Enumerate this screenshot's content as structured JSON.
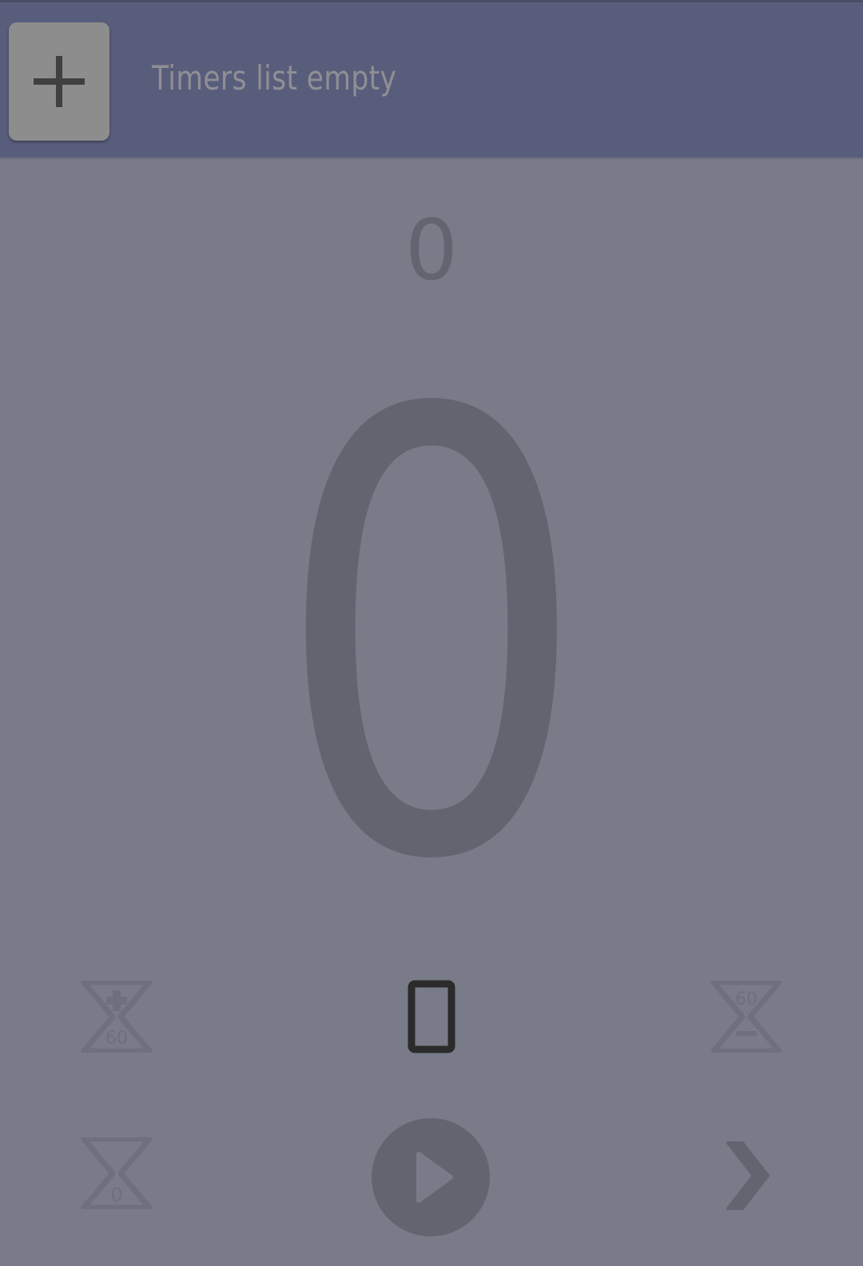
{
  "header": {
    "add_icon": "plus-icon",
    "title": "Timers list empty"
  },
  "counter": {
    "small_value": "0",
    "large_value": "0"
  },
  "controls": {
    "add_60_icon": {
      "name": "hourglass-plus-60-icon",
      "label": "60"
    },
    "screen_icon": "phone-screen-icon",
    "subtract_60_icon": {
      "name": "hourglass-minus-60-icon",
      "label": "60"
    },
    "reset_icon": {
      "name": "hourglass-zero-icon",
      "label": "0"
    },
    "play_icon": "play-icon",
    "next_icon": "chevron-right-icon"
  },
  "colors": {
    "header_bg": "#595d7c",
    "body_bg": "#797b88",
    "digit_color": "#62646f",
    "title_color": "#8f8f94",
    "add_button_bg": "#8d8d8d"
  }
}
